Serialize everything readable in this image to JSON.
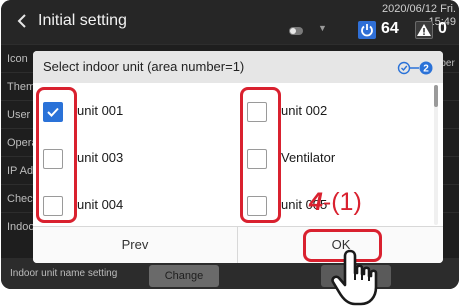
{
  "topbar": {
    "title": "Initial setting",
    "datetime": "2020/06/12 Fri. 15:49",
    "power_count": "64",
    "warning_count": "0"
  },
  "background": {
    "rows": [
      "Icon",
      "Theme",
      "User",
      "Operation",
      "IP Ad",
      "Check",
      "Indoor"
    ],
    "right_label": "mber",
    "bottom_label": "Indoor unit name setting",
    "change_label": "Change",
    "cancel_label": "Ca"
  },
  "dialog": {
    "title": "Select indoor unit (area number=1)",
    "units": [
      {
        "label": "unit 001",
        "checked": true
      },
      {
        "label": "unit 003",
        "checked": false
      },
      {
        "label": "unit 004",
        "checked": false
      },
      {
        "label": "unit 002",
        "checked": false
      },
      {
        "label": "Ventilator",
        "checked": false
      },
      {
        "label": "unit 005",
        "checked": false
      }
    ],
    "prev_label": "Prev",
    "ok_label": "OK"
  },
  "annotation": {
    "step_number": "4",
    "step_suffix": "-(1)"
  },
  "colors": {
    "accent": "#2a72d8",
    "annotation": "#d9212f",
    "screen_bg": "#1e1e1e"
  },
  "icons": [
    "back-chevron-icon",
    "power-icon",
    "warning-icon",
    "checkmark-icon",
    "step-indicator-icon",
    "pointing-hand-icon"
  ]
}
